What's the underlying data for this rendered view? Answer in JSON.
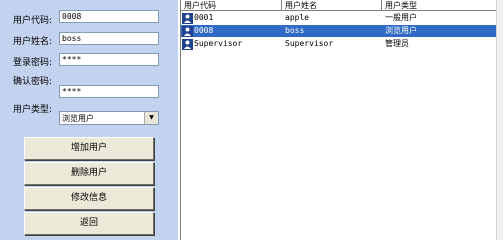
{
  "form": {
    "user_code_label": "用户代码:",
    "user_code_value": "0008",
    "user_name_label": "用户姓名:",
    "user_name_value": "boss",
    "password_label": "登录密码:",
    "password_value": "****",
    "confirm_label": "确认密码:",
    "confirm_value": "****",
    "user_type_label": "用户类型:",
    "user_type_value": "浏览用户"
  },
  "buttons": {
    "add": "增加用户",
    "delete": "删除用户",
    "modify": "修改信息",
    "back": "返回"
  },
  "table": {
    "headers": [
      "用户代码",
      "用户姓名",
      "用户类型"
    ],
    "rows": [
      {
        "code": "0001",
        "name": "apple",
        "type": "一般用户",
        "selected": false
      },
      {
        "code": "0008",
        "name": "boss",
        "type": "浏览用户",
        "selected": true
      },
      {
        "code": "Supervisor",
        "name": "Supervisor",
        "type": "管理员",
        "selected": false
      }
    ]
  },
  "colors": {
    "panel": "#c3d3ef",
    "selection": "#316ac5",
    "button_face": "#ece9d8"
  },
  "icons": {
    "row_icon": "user-icon",
    "dropdown": "chevron-down-icon"
  }
}
